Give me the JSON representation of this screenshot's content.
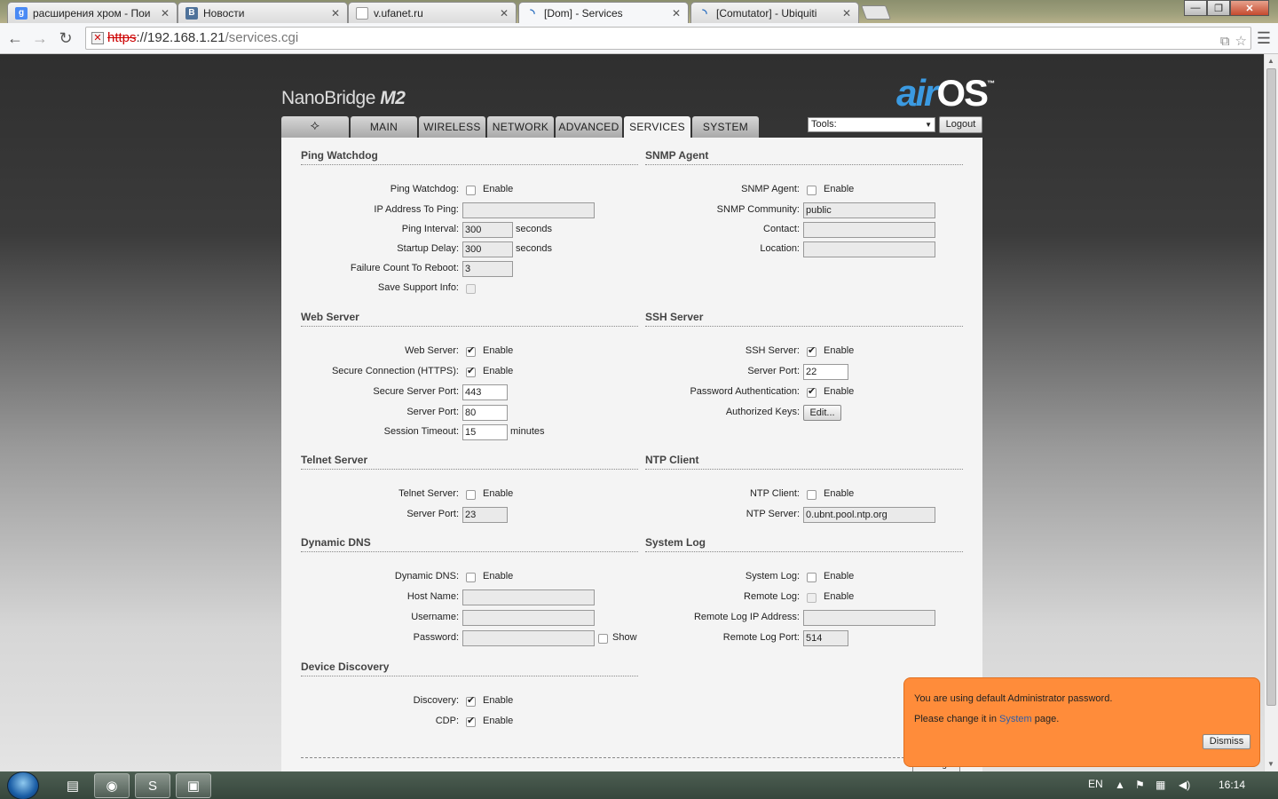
{
  "browser": {
    "tabs": [
      {
        "title": "расширения хром - Пои",
        "icon": "google-favicon",
        "active": false
      },
      {
        "title": "Новости",
        "icon": "vk-favicon",
        "active": false
      },
      {
        "title": "v.ufanet.ru",
        "icon": "page-favicon",
        "active": false
      },
      {
        "title": "[Dom] - Services",
        "icon": "ubnt-favicon",
        "active": true
      },
      {
        "title": "[Comutator] - Ubiquiti",
        "icon": "ubnt-favicon",
        "active": false
      }
    ],
    "url": {
      "scheme": "https",
      "host": "://192.168.1.21",
      "path": "/services.cgi"
    },
    "window_controls": {
      "minimize": "—",
      "maximize": "❐",
      "close": "✕"
    }
  },
  "header": {
    "brand_prefix": "NanoBridge",
    "brand_model": "M2",
    "logo_air": "air",
    "logo_os": "OS",
    "logo_tm": "™",
    "tabs": [
      "MAIN",
      "WIRELESS",
      "NETWORK",
      "ADVANCED",
      "SERVICES",
      "SYSTEM"
    ],
    "active_tab": "SERVICES",
    "tools_select": "Tools:",
    "logout": "Logout"
  },
  "ping_watchdog": {
    "title": "Ping Watchdog",
    "enable_label": "Ping Watchdog:",
    "enable_text": "Enable",
    "ip_label": "IP Address To Ping:",
    "ip_value": "",
    "interval_label": "Ping Interval:",
    "interval_value": "300",
    "interval_unit": "seconds",
    "delay_label": "Startup Delay:",
    "delay_value": "300",
    "delay_unit": "seconds",
    "failure_label": "Failure Count To Reboot:",
    "failure_value": "3",
    "support_label": "Save Support Info:"
  },
  "snmp": {
    "title": "SNMP Agent",
    "enable_label": "SNMP Agent:",
    "enable_text": "Enable",
    "community_label": "SNMP Community:",
    "community_value": "public",
    "contact_label": "Contact:",
    "contact_value": "",
    "location_label": "Location:",
    "location_value": ""
  },
  "web_server": {
    "title": "Web Server",
    "enable_label": "Web Server:",
    "enable_text": "Enable",
    "https_label": "Secure Connection (HTTPS):",
    "https_text": "Enable",
    "secure_port_label": "Secure Server Port:",
    "secure_port_value": "443",
    "port_label": "Server Port:",
    "port_value": "80",
    "timeout_label": "Session Timeout:",
    "timeout_value": "15",
    "timeout_unit": "minutes"
  },
  "ssh": {
    "title": "SSH Server",
    "enable_label": "SSH Server:",
    "enable_text": "Enable",
    "port_label": "Server Port:",
    "port_value": "22",
    "pwauth_label": "Password Authentication:",
    "pwauth_text": "Enable",
    "keys_label": "Authorized Keys:",
    "keys_button": "Edit..."
  },
  "telnet": {
    "title": "Telnet Server",
    "enable_label": "Telnet Server:",
    "enable_text": "Enable",
    "port_label": "Server Port:",
    "port_value": "23"
  },
  "ntp": {
    "title": "NTP Client",
    "enable_label": "NTP Client:",
    "enable_text": "Enable",
    "server_label": "NTP Server:",
    "server_value": "0.ubnt.pool.ntp.org"
  },
  "ddns": {
    "title": "Dynamic DNS",
    "enable_label": "Dynamic DNS:",
    "enable_text": "Enable",
    "host_label": "Host Name:",
    "host_value": "",
    "user_label": "Username:",
    "user_value": "",
    "pass_label": "Password:",
    "pass_value": "",
    "show_text": "Show"
  },
  "syslog": {
    "title": "System Log",
    "enable_label": "System Log:",
    "enable_text": "Enable",
    "remote_label": "Remote Log:",
    "remote_text": "Enable",
    "remote_ip_label": "Remote Log IP Address:",
    "remote_ip_value": "",
    "remote_port_label": "Remote Log Port:",
    "remote_port_value": "514"
  },
  "discovery": {
    "title": "Device Discovery",
    "discovery_label": "Discovery:",
    "discovery_text": "Enable",
    "cdp_label": "CDP:",
    "cdp_text": "Enable"
  },
  "bottom": {
    "change_button": "Change"
  },
  "notification": {
    "line1": "You are using default Administrator password.",
    "line2_pre": "Please change it in",
    "line2_link": "System",
    "line2_post": "page.",
    "dismiss": "Dismiss"
  },
  "taskbar": {
    "lang": "EN",
    "clock": "16:14"
  }
}
